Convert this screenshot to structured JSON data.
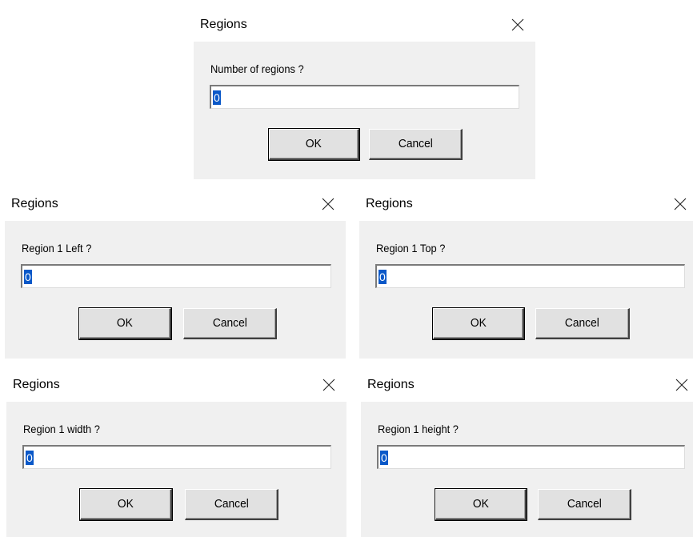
{
  "dialogs": [
    {
      "title": "Regions",
      "prompt": "Number of regions ?",
      "value": "0",
      "ok_label": "OK",
      "cancel_label": "Cancel"
    },
    {
      "title": "Regions",
      "prompt": "Region 1 Left ?",
      "value": "0",
      "ok_label": "OK",
      "cancel_label": "Cancel"
    },
    {
      "title": "Regions",
      "prompt": "Region 1 Top ?",
      "value": "0",
      "ok_label": "OK",
      "cancel_label": "Cancel"
    },
    {
      "title": "Regions",
      "prompt": "Region 1 width ?",
      "value": "0",
      "ok_label": "OK",
      "cancel_label": "Cancel"
    },
    {
      "title": "Regions",
      "prompt": "Region 1 height ?",
      "value": "0",
      "ok_label": "OK",
      "cancel_label": "Cancel"
    }
  ],
  "icons": {
    "close": "close-icon"
  },
  "colors": {
    "dialog_bg": "#f0f0f0",
    "titlebar_bg": "#ffffff",
    "selection": "#0a58c8"
  }
}
